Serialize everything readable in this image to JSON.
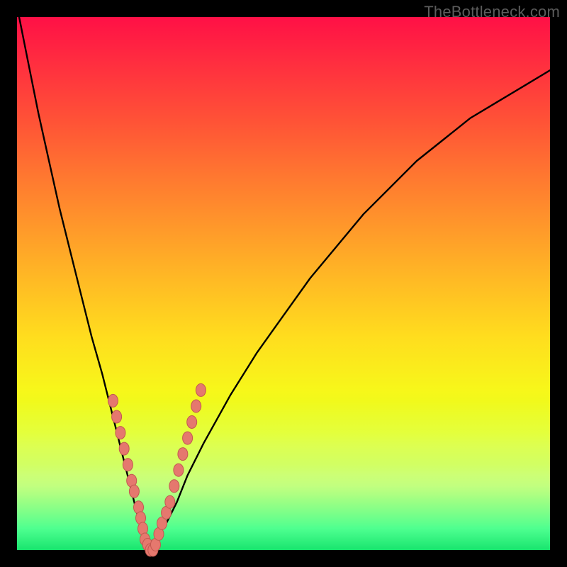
{
  "attribution": "TheBottleneck.com",
  "colors": {
    "bg": "#000000",
    "curve_stroke": "#000000",
    "marker_fill": "#e5786e",
    "marker_stroke": "#c25850"
  },
  "chart_data": {
    "type": "line",
    "title": "",
    "xlabel": "",
    "ylabel": "",
    "xlim": [
      0,
      100
    ],
    "ylim": [
      0,
      100
    ],
    "grid": false,
    "legend": false,
    "series": [
      {
        "name": "bottleneck-curve",
        "x": [
          0,
          2,
          4,
          6,
          8,
          10,
          12,
          14,
          16,
          18,
          20,
          21,
          22,
          23,
          24,
          25,
          26,
          28,
          30,
          32,
          35,
          40,
          45,
          50,
          55,
          60,
          65,
          70,
          75,
          80,
          85,
          90,
          95,
          100
        ],
        "y": [
          102,
          92,
          82,
          73,
          64,
          56,
          48,
          40,
          33,
          25,
          17,
          13,
          9,
          5,
          2,
          0,
          2,
          5,
          9,
          14,
          20,
          29,
          37,
          44,
          51,
          57,
          63,
          68,
          73,
          77,
          81,
          84,
          87,
          90
        ]
      }
    ],
    "markers": {
      "name": "highlighted-points",
      "points": [
        {
          "x": 18.0,
          "y": 28
        },
        {
          "x": 18.7,
          "y": 25
        },
        {
          "x": 19.4,
          "y": 22
        },
        {
          "x": 20.1,
          "y": 19
        },
        {
          "x": 20.8,
          "y": 16
        },
        {
          "x": 21.5,
          "y": 13
        },
        {
          "x": 22.0,
          "y": 11
        },
        {
          "x": 22.8,
          "y": 8
        },
        {
          "x": 23.2,
          "y": 6
        },
        {
          "x": 23.6,
          "y": 4
        },
        {
          "x": 24.0,
          "y": 2
        },
        {
          "x": 24.5,
          "y": 1
        },
        {
          "x": 25.0,
          "y": 0
        },
        {
          "x": 25.5,
          "y": 0
        },
        {
          "x": 26.0,
          "y": 1
        },
        {
          "x": 26.6,
          "y": 3
        },
        {
          "x": 27.2,
          "y": 5
        },
        {
          "x": 28.0,
          "y": 7
        },
        {
          "x": 28.7,
          "y": 9
        },
        {
          "x": 29.5,
          "y": 12
        },
        {
          "x": 30.3,
          "y": 15
        },
        {
          "x": 31.1,
          "y": 18
        },
        {
          "x": 32.0,
          "y": 21
        },
        {
          "x": 32.8,
          "y": 24
        },
        {
          "x": 33.6,
          "y": 27
        },
        {
          "x": 34.5,
          "y": 30
        }
      ]
    }
  }
}
